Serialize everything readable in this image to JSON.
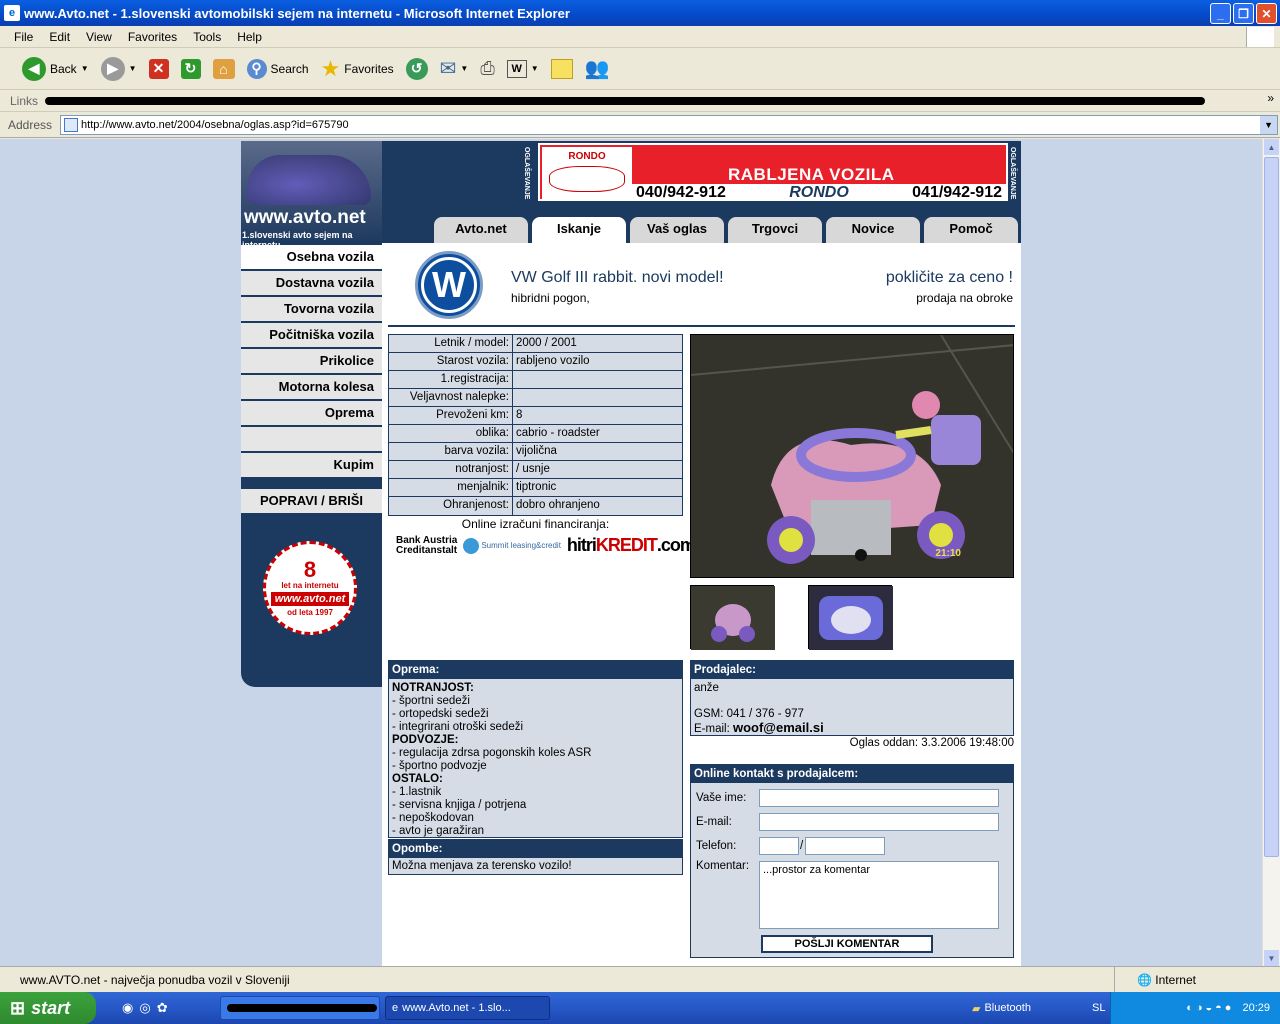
{
  "window": {
    "title": "www.Avto.net - 1.slovenski avtomobilski sejem na internetu - Microsoft Internet Explorer"
  },
  "menubar": [
    "File",
    "Edit",
    "View",
    "Favorites",
    "Tools",
    "Help"
  ],
  "toolbar": {
    "back_label": "Back",
    "search_label": "Search",
    "favorites_label": "Favorites"
  },
  "links_label": "Links",
  "address": {
    "label": "Address",
    "url": "http://www.avto.net/2004/osebna/oglas.asp?id=675790"
  },
  "site": {
    "logo_title": "www.avto.net",
    "logo_subtitle": "1.slovenski avto sejem na internetu",
    "banner_side_label": "OGLAŠEVANJE",
    "banner": {
      "logo_text": "RONDO",
      "headline": "RABLJENA VOZILA",
      "phone_left": "040/942-912",
      "brand": "RONDO",
      "phone_right": "041/942-912"
    },
    "tabs": [
      "Avto.net",
      "Iskanje",
      "Vaš oglas",
      "Trgovci",
      "Novice",
      "Pomoč"
    ],
    "active_tab": "Iskanje",
    "sidebar": {
      "items": [
        "Osebna vozila",
        "Dostavna vozila",
        "Tovorna vozila",
        "Počitniška vozila",
        "Prikolice",
        "Motorna kolesa",
        "Oprema"
      ],
      "buy": "Kupim",
      "edit": "POPRAVI / BRIŠI",
      "badge": {
        "number": "8",
        "top": "let na internetu",
        "site": "www.avto.net",
        "since": "od leta 1997"
      }
    }
  },
  "ad": {
    "title": "VW Golf III rabbit. novi model!",
    "subtitle": "hibridni pogon,",
    "price": "pokličite za ceno !",
    "price_note": "prodaja na obroke",
    "specs": [
      {
        "k": "Letnik / model:",
        "v": "2000 / 2001"
      },
      {
        "k": "Starost vozila:",
        "v": "rabljeno vozilo"
      },
      {
        "k": "1.registracija:",
        "v": ""
      },
      {
        "k": "Veljavnost nalepke:",
        "v": ""
      },
      {
        "k": "Prevoženi km:",
        "v": "8"
      },
      {
        "k": "oblika:",
        "v": "cabrio - roadster"
      },
      {
        "k": "barva vozila:",
        "v": "vijolična"
      },
      {
        "k": "notranjost:",
        "v": " / usnje"
      },
      {
        "k": "menjalnik:",
        "v": "tiptronic"
      },
      {
        "k": "Ohranjenost:",
        "v": "dobro ohranjeno"
      }
    ],
    "financing_label": "Online izračuni financiranja:",
    "financing": {
      "bank1": "Bank Austria",
      "bank2": "Creditanstalt",
      "summit": "Summit leasing&credit",
      "hitri": "hitri",
      "kredit": "KREDIT",
      "com": ".com"
    },
    "photo_timestamp": "21:10",
    "oprema": {
      "header": "Oprema:",
      "lines": [
        {
          "t": "NOTRANJOST:",
          "b": true
        },
        {
          "t": "- športni sedeži",
          "b": false
        },
        {
          "t": "- ortopedski sedeži",
          "b": false
        },
        {
          "t": "- integrirani otroški sedeži",
          "b": false
        },
        {
          "t": "PODVOZJE:",
          "b": true
        },
        {
          "t": "- regulacija zdrsa pogonskih koles ASR",
          "b": false
        },
        {
          "t": "- športno podvozje",
          "b": false
        },
        {
          "t": "OSTALO:",
          "b": true
        },
        {
          "t": "- 1.lastnik",
          "b": false
        },
        {
          "t": "- servisna knjiga / potrjena",
          "b": false
        },
        {
          "t": "- nepoškodovan",
          "b": false
        },
        {
          "t": "- avto je garažiran",
          "b": false
        }
      ]
    },
    "opombe": {
      "header": "Opombe:",
      "text": "Možna menjava za terensko vozilo!"
    },
    "seller": {
      "header": "Prodajalec:",
      "name": "anže",
      "gsm": "GSM: 041 / 376 - 977",
      "email_label": "E-mail:",
      "email": "woof@email.si"
    },
    "posted": "Oglas oddan: 3.3.2006 19:48:00",
    "contact_form": {
      "header": "Online kontakt s prodajalcem:",
      "name_label": "Vaše ime:",
      "email_label": "E-mail:",
      "phone_label": "Telefon:",
      "comment_label": "Komentar:",
      "comment_placeholder": "...prostor za komentar",
      "submit": "POŠLJI KOMENTAR"
    }
  },
  "statusbar": {
    "text": "www.AVTO.net - največja ponudba vozil v Sloveniji",
    "zone": "Internet"
  },
  "taskbar": {
    "start": "start",
    "task": "www.Avto.net - 1.slo...",
    "bluetooth": "Bluetooth",
    "lang": "SL",
    "clock": "20:29"
  }
}
